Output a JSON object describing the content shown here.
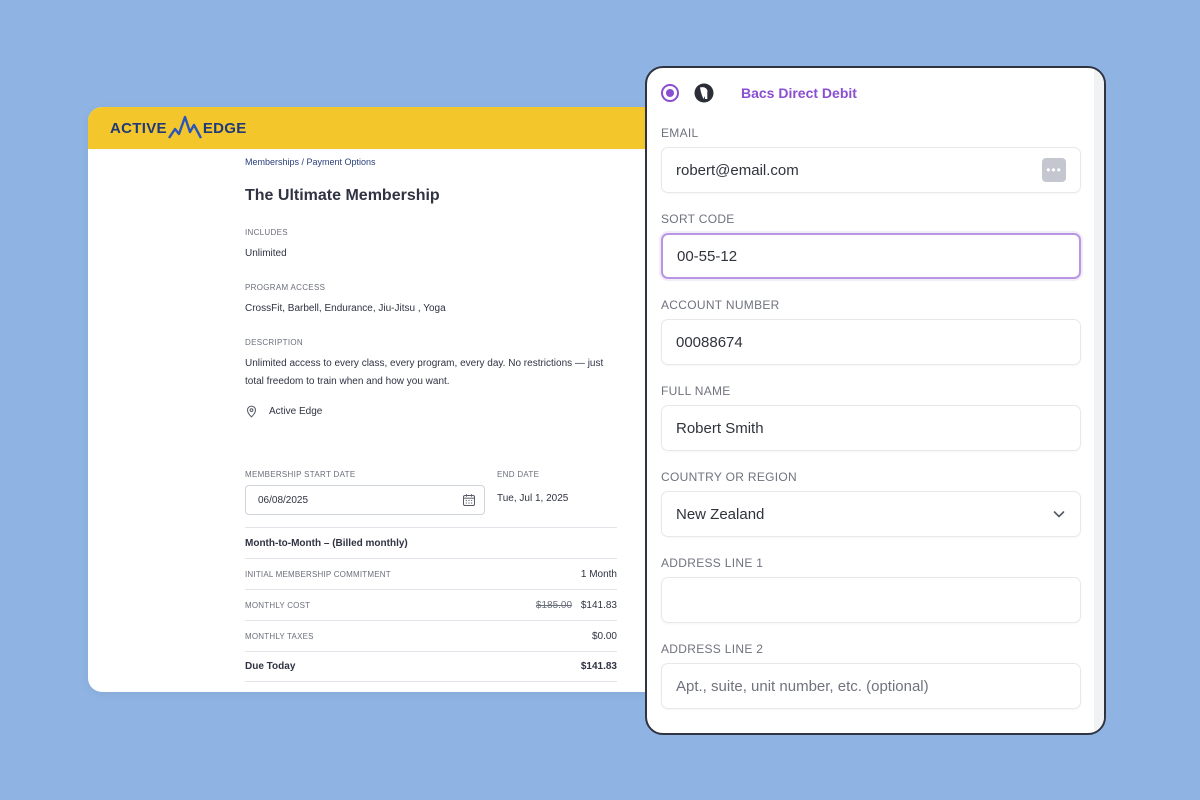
{
  "brand": {
    "logo_left": "ACTIVE",
    "logo_right": "EDGE",
    "accent": "#f3c62c",
    "logo_color": "#1f3a78"
  },
  "breadcrumb": "Memberships / Payment Options",
  "membership": {
    "title": "The Ultimate Membership",
    "includes_label": "INCLUDES",
    "includes_value": "Unlimited",
    "program_label": "PROGRAM ACCESS",
    "program_value": "CrossFit, Barbell, Endurance, Jiu-Jitsu , Yoga",
    "description_label": "DESCRIPTION",
    "description_value": "Unlimited access to every class, every program, every day. No restrictions — just total freedom to train when and how you want.",
    "location": "Active Edge",
    "location_icon": "map-pin-icon",
    "start_date_label": "MEMBERSHIP START DATE",
    "start_date_value": "06/08/2025",
    "end_date_label": "END DATE",
    "end_date_value": "Tue, Jul 1, 2025",
    "plan_name": "Month-to-Month – (Billed monthly)",
    "rows": {
      "commitment_label": "INITIAL MEMBERSHIP COMMITMENT",
      "commitment_value": "1 Month",
      "monthly_cost_label": "MONTHLY COST",
      "monthly_cost_original": "$185.00",
      "monthly_cost_value": "$141.83",
      "monthly_taxes_label": "MONTHLY TAXES",
      "monthly_taxes_value": "$0.00",
      "due_today_label": "Due Today",
      "due_today_value": "$141.83"
    }
  },
  "payment": {
    "method_label": "Bacs Direct Debit",
    "method_color": "#8a4fd1",
    "email_label": "EMAIL",
    "email_value": "robert@email.com",
    "email_icon": "autofill-icon",
    "email_icon_glyph": "•••",
    "sort_code_label": "SORT CODE",
    "sort_code_value": "00-55-12",
    "account_number_label": "ACCOUNT NUMBER",
    "account_number_value": "00088674",
    "full_name_label": "FULL NAME",
    "full_name_value": "Robert Smith",
    "country_label": "COUNTRY OR REGION",
    "country_value": "New Zealand",
    "address1_label": "ADDRESS LINE 1",
    "address1_value": "",
    "address2_label": "ADDRESS LINE 2",
    "address2_placeholder": "Apt., suite, unit number, etc. (optional)"
  }
}
